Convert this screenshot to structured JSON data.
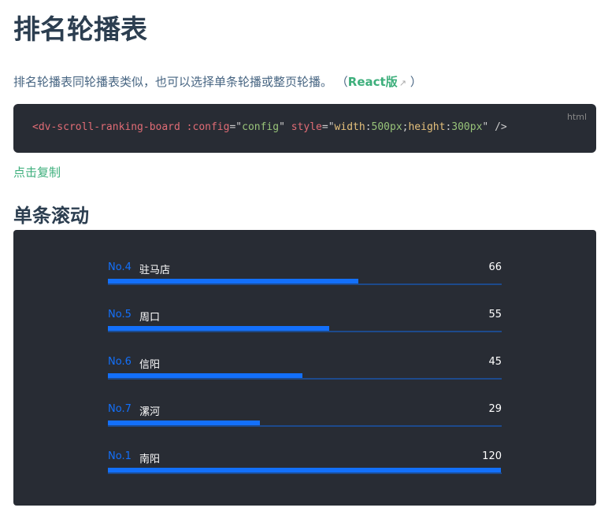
{
  "title": "排名轮播表",
  "description": "排名轮播表同轮播表类似，也可以选择单条轮播或整页轮播。 （",
  "react_link": "React版",
  "desc_close": " ）",
  "code": {
    "lang": "html",
    "tag_open": "<dv-scroll-ranking-board",
    "attr1": " :config",
    "eq1": "=\"",
    "val1": "config",
    "q1": "\" ",
    "attr2": "style",
    "eq2": "=\"",
    "k1": "width",
    "c1": ":",
    "v1": "500px",
    "semi": ";",
    "k2": "height",
    "c2": ":",
    "v2": "300px",
    "q2": "\"",
    "close": " />"
  },
  "copy_label": "点击复制",
  "section_title": "单条滚动",
  "ranking": [
    {
      "rank": "No.4",
      "name": "驻马店",
      "value": 66
    },
    {
      "rank": "No.5",
      "name": "周口",
      "value": 55
    },
    {
      "rank": "No.6",
      "name": "信阳",
      "value": 45
    },
    {
      "rank": "No.7",
      "name": "漯河",
      "value": 29
    },
    {
      "rank": "No.1",
      "name": "南阳",
      "value": 120
    }
  ],
  "colors": {
    "bar": "#1370fb",
    "link": "#3eaf7c"
  }
}
